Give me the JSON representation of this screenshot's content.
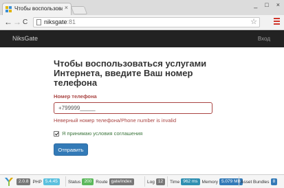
{
  "browser": {
    "tab_title": "Чтобы воспользоваться",
    "tab_close": "×",
    "window_controls": [
      "_",
      "□",
      "×"
    ],
    "back": "←",
    "forward": "→",
    "reload": "C",
    "url_host": "niksgate",
    "url_port": ":81",
    "star": "☆"
  },
  "navbar": {
    "brand": "NiksGate",
    "login": "Вход"
  },
  "form": {
    "heading_line1": "Чтобы воспользоваться услугами",
    "heading_line2": "Интернета, введите Ваш номер телефона",
    "phone_label": "Номер телефона",
    "phone_value": "+799999_____",
    "error": "Неверный номер телефона/Phone number is invalid",
    "agree_label": "Я принимаю условия соглашения",
    "agree_checked": true,
    "submit": "Отправить"
  },
  "debug": {
    "yii_version": "2.0.8",
    "php_label": "PHP",
    "php_version": "5.4.45",
    "status_label": "Status",
    "status_value": "200",
    "route_label": "Route",
    "route_value": "gate/index",
    "log_label": "Log",
    "log_value": "12",
    "time_label": "Time",
    "time_value": "962 ms",
    "memory_label": "Memory",
    "memory_value": "5.079 MB",
    "assets_label": "Asset Bundles",
    "assets_value": "8"
  },
  "colors": {
    "error": "#a94442",
    "success": "#3c763d",
    "primary": "#337ab7",
    "navbar": "#222222"
  }
}
